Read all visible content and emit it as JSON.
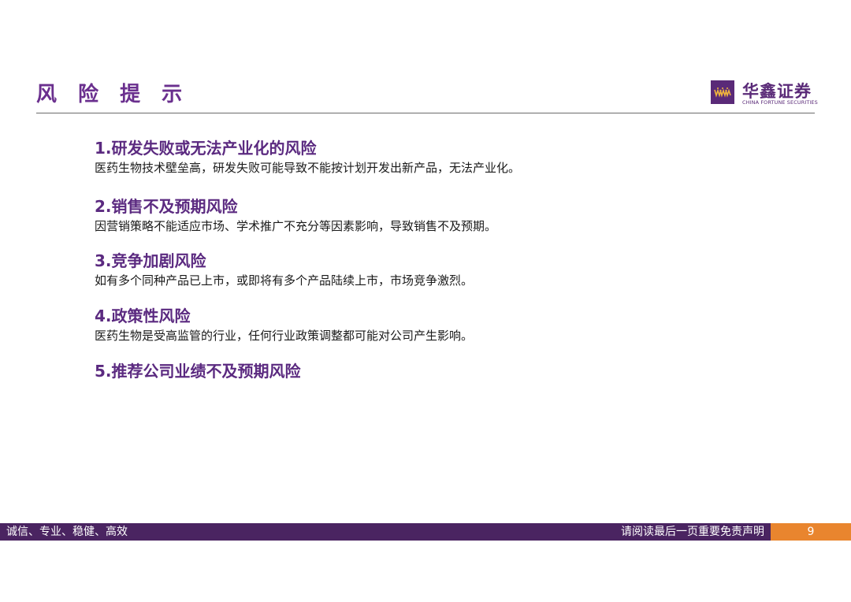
{
  "header": {
    "title": "风 险 提 示",
    "logo": {
      "name_cn": "华鑫证券",
      "name_en": "CHINA FORTUNE SECURITIES",
      "icon": "china-fortune-logo-mark",
      "brand_color": "#5a2a78"
    }
  },
  "risks": [
    {
      "heading": "1.研发失败或无法产业化的风险",
      "description": "医药生物技术壁垒高，研发失败可能导致不能按计划开发出新产品，无法产业化。"
    },
    {
      "heading": "2.销售不及预期风险",
      "description": "因营销策略不能适应市场、学术推广不充分等因素影响，导致销售不及预期。"
    },
    {
      "heading": "3.竞争加剧风险",
      "description": "如有多个同种产品已上市，或即将有多个产品陆续上市，市场竞争激烈。"
    },
    {
      "heading": "4.政策性风险",
      "description": "医药生物是受高监管的行业，任何行业政策调整都可能对公司产生影响。"
    },
    {
      "heading": "5.推荐公司业绩不及预期风险",
      "description": ""
    }
  ],
  "footer": {
    "motto": "诚信、专业、稳健、高效",
    "disclaimer": "请阅读最后一页重要免责声明",
    "page_number": "9",
    "bar_color": "#4a2461",
    "page_box_color": "#e9852e"
  },
  "colors": {
    "accent": "#6a2f8e",
    "heading": "#5b2a80"
  }
}
